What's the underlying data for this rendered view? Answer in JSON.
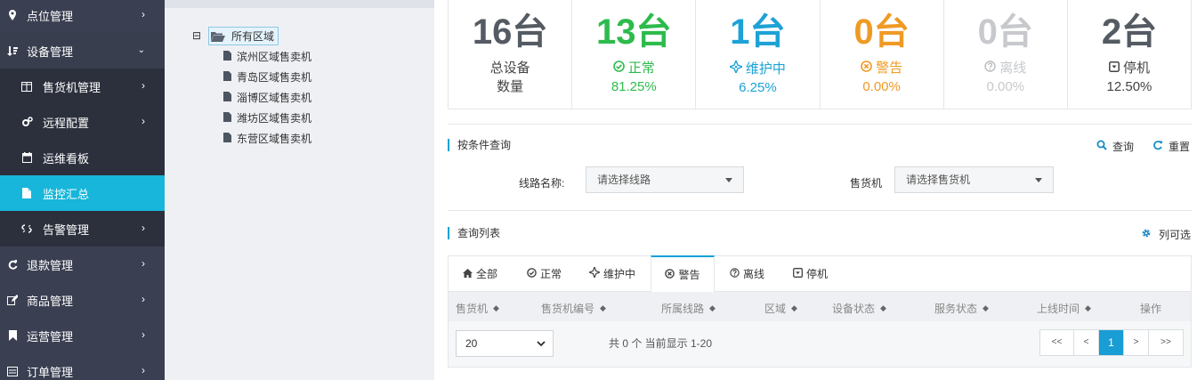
{
  "colors": {
    "normal": "#2dbb4c",
    "maintain": "#1da2d6",
    "warn": "#ef9a25",
    "offline": "#c7c9cc",
    "stop": "#555b63",
    "total": "#555b63",
    "accent": "#17b6da"
  },
  "sidebar": {
    "items": [
      {
        "label": "点位管理",
        "icon": "map-marker-icon",
        "type": "top"
      },
      {
        "label": "设备管理",
        "icon": "sort-amount-icon",
        "type": "top",
        "open": true
      },
      {
        "label": "售货机管理",
        "icon": "columns-icon",
        "type": "sub"
      },
      {
        "label": "远程配置",
        "icon": "cogs-icon",
        "type": "sub"
      },
      {
        "label": "运维看板",
        "icon": "calendar-icon",
        "type": "sub"
      },
      {
        "label": "监控汇总",
        "icon": "file-icon",
        "type": "sub",
        "active": true
      },
      {
        "label": "告警管理",
        "icon": "unlink-icon",
        "type": "sub"
      },
      {
        "label": "退款管理",
        "icon": "refresh-icon",
        "type": "top"
      },
      {
        "label": "商品管理",
        "icon": "edit-icon",
        "type": "top"
      },
      {
        "label": "运营管理",
        "icon": "bookmark-icon",
        "type": "top"
      },
      {
        "label": "订单管理",
        "icon": "list-icon",
        "type": "top"
      }
    ]
  },
  "tree": {
    "toggle": "⊟",
    "root": "所有区域",
    "children": [
      "滨州区域售卖机",
      "青岛区域售卖机",
      "淄博区域售卖机",
      "潍坊区域售卖机",
      "东营区域售卖机"
    ]
  },
  "stats": [
    {
      "num": "16台",
      "label": "总设备",
      "sub": "数量",
      "icon": ""
    },
    {
      "num": "13台",
      "label": "正常",
      "sub": "81.25%",
      "icon": "check-circle-icon"
    },
    {
      "num": "1台",
      "label": "维护中",
      "sub": "6.25%",
      "icon": "crosshairs-icon"
    },
    {
      "num": "0台",
      "label": "警告",
      "sub": "0.00%",
      "icon": "times-circle-icon"
    },
    {
      "num": "0台",
      "label": "离线",
      "sub": "0.00%",
      "icon": "question-circle-icon"
    },
    {
      "num": "2台",
      "label": "停机",
      "sub": "12.50%",
      "icon": "caret-square-icon"
    }
  ],
  "search": {
    "title": "按条件查询",
    "query": "查询",
    "reset": "重置",
    "route_label": "线路名称:",
    "route_placeholder": "请选择线路",
    "vm_label": "售货机",
    "vm_placeholder": "请选择售货机"
  },
  "list": {
    "title": "查询列表",
    "columns_btn": "列可选",
    "tabs": [
      {
        "label": "全部",
        "icon": "home-icon"
      },
      {
        "label": "正常",
        "icon": "check-circle-icon"
      },
      {
        "label": "维护中",
        "icon": "crosshairs-icon"
      },
      {
        "label": "警告",
        "icon": "times-circle-icon",
        "active": true
      },
      {
        "label": "离线",
        "icon": "question-circle-icon"
      },
      {
        "label": "停机",
        "icon": "caret-square-icon"
      }
    ],
    "headers": [
      "售货机",
      "售货机编号",
      "所属线路",
      "区域",
      "设备状态",
      "服务状态",
      "上线时间",
      "操作"
    ],
    "page_size": "20",
    "page_info": "共 0 个 当前显示 1-20",
    "pager": [
      "<<",
      "<",
      "1",
      ">",
      ">>"
    ]
  }
}
